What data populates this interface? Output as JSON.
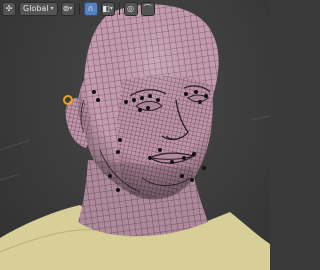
{
  "header": {
    "orientation_label": "Global",
    "pivot_icon": "pivot-point-icon",
    "snap_icon": "snap-magnet-icon",
    "snap_target_icon": "snap-target-icon",
    "proportional_icon": "proportional-edit-icon"
  },
  "colors": {
    "viewport_bg": "#3a3a3a",
    "mesh_skin": "#c9a0b4",
    "wire": "#2b1d26",
    "torso": "#d9cf9a",
    "ear_ring": "#f0a21a",
    "active_button": "#5680c2"
  },
  "viewport": {
    "object": "human-head-mesh",
    "mode": "edit-mode-wireframe"
  }
}
